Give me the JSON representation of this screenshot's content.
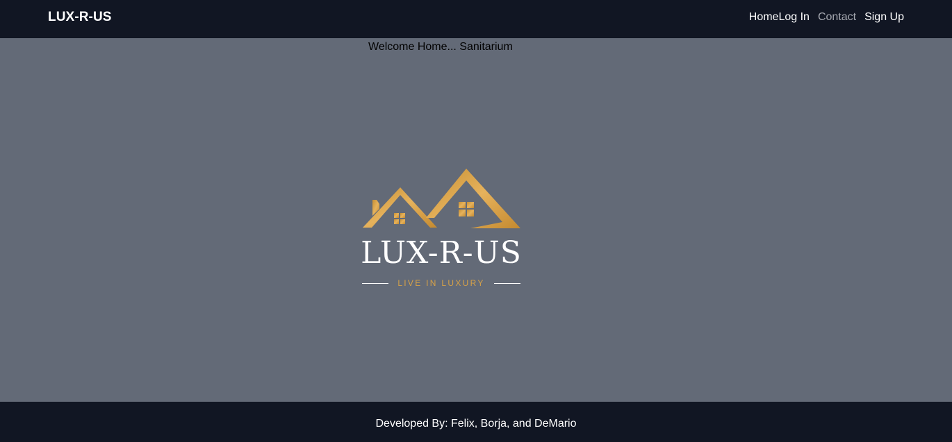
{
  "navbar": {
    "brand": "LUX-R-US",
    "links": [
      {
        "label": "Home"
      },
      {
        "label": "Log In"
      },
      {
        "label": "Contact"
      },
      {
        "label": "Sign Up"
      }
    ]
  },
  "main": {
    "welcome_text": "Welcome Home... Sanitarium",
    "logo": {
      "title": "LUX-R-US",
      "tagline": "LIVE IN LUXURY",
      "icon": "houses-roof-icon"
    }
  },
  "footer": {
    "credits": "Developed By: Felix, Borja, and DeMario"
  },
  "colors": {
    "navbar_bg": "#111623",
    "page_bg": "#636a77",
    "gold": "#d6a148",
    "muted_link": "#a6a9b1"
  }
}
